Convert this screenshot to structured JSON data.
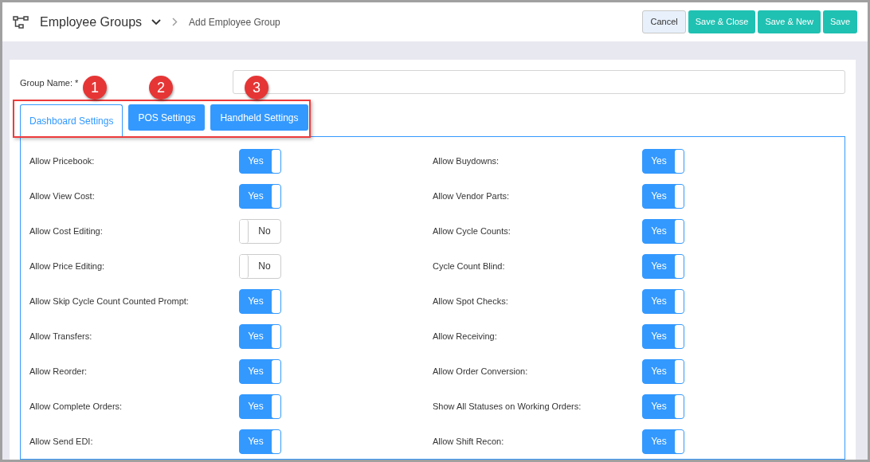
{
  "header": {
    "title": "Employee Groups",
    "breadcrumb": "Add Employee Group"
  },
  "actions": [
    {
      "label": "Cancel",
      "kind": "secondary"
    },
    {
      "label": "Save & Close",
      "kind": "primary"
    },
    {
      "label": "Save & New",
      "kind": "primary"
    },
    {
      "label": "Save",
      "kind": "primary"
    }
  ],
  "group_name": {
    "label": "Group Name: *"
  },
  "tabs": [
    {
      "label": "Dashboard Settings",
      "selected": true,
      "callout": "1"
    },
    {
      "label": "POS Settings",
      "selected": false,
      "callout": "2"
    },
    {
      "label": "Handheld Settings",
      "selected": false,
      "callout": "3"
    }
  ],
  "settings": [
    {
      "label": "Allow Pricebook:",
      "on": true,
      "text": "Yes"
    },
    {
      "label": "Allow Buydowns:",
      "on": true,
      "text": "Yes"
    },
    {
      "label": "Allow View Cost:",
      "on": true,
      "text": "Yes"
    },
    {
      "label": "Allow Vendor Parts:",
      "on": true,
      "text": "Yes"
    },
    {
      "label": "Allow Cost Editing:",
      "on": false,
      "text": "No"
    },
    {
      "label": "Allow Cycle Counts:",
      "on": true,
      "text": "Yes"
    },
    {
      "label": "Allow Price Editing:",
      "on": false,
      "text": "No"
    },
    {
      "label": "Cycle Count Blind:",
      "on": true,
      "text": "Yes"
    },
    {
      "label": "Allow Skip Cycle Count Counted Prompt:",
      "on": true,
      "text": "Yes"
    },
    {
      "label": "Allow Spot Checks:",
      "on": true,
      "text": "Yes"
    },
    {
      "label": "Allow Transfers:",
      "on": true,
      "text": "Yes"
    },
    {
      "label": "Allow Receiving:",
      "on": true,
      "text": "Yes"
    },
    {
      "label": "Allow Reorder:",
      "on": true,
      "text": "Yes"
    },
    {
      "label": "Allow Order Conversion:",
      "on": true,
      "text": "Yes"
    },
    {
      "label": "Allow Complete Orders:",
      "on": true,
      "text": "Yes"
    },
    {
      "label": "Show All Statuses on Working Orders:",
      "on": true,
      "text": "Yes"
    },
    {
      "label": "Allow Send EDI:",
      "on": true,
      "text": "Yes"
    },
    {
      "label": "Allow Shift Recon:",
      "on": true,
      "text": "Yes"
    }
  ]
}
